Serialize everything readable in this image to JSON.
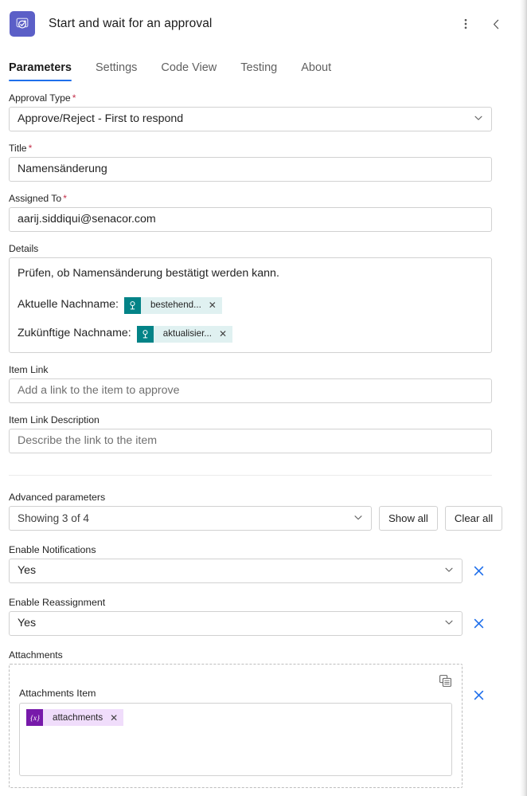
{
  "header": {
    "title": "Start and wait for an approval",
    "app_icon": "approval-icon",
    "more_icon": "more-vertical-icon",
    "collapse_icon": "chevron-left-icon"
  },
  "tabs": [
    {
      "label": "Parameters",
      "active": true
    },
    {
      "label": "Settings",
      "active": false
    },
    {
      "label": "Code View",
      "active": false
    },
    {
      "label": "Testing",
      "active": false
    },
    {
      "label": "About",
      "active": false
    }
  ],
  "fields": {
    "approval_type": {
      "label": "Approval Type",
      "required": true,
      "value": "Approve/Reject - First to respond"
    },
    "title": {
      "label": "Title",
      "required": true,
      "value": "Namensänderung"
    },
    "assigned_to": {
      "label": "Assigned To",
      "required": true,
      "value": "aarij.siddiqui@senacor.com"
    },
    "details": {
      "label": "Details",
      "line1": "Prüfen, ob Namensänderung bestätigt werden kann.",
      "line2_label": "Aktuelle Nachname:",
      "line2_token": "bestehend...",
      "line3_label": "Zukünftige Nachname:",
      "line3_token": "aktualisier..."
    },
    "item_link": {
      "label": "Item Link",
      "placeholder": "Add a link to the item to approve",
      "value": ""
    },
    "item_link_description": {
      "label": "Item Link Description",
      "placeholder": "Describe the link to the item",
      "value": ""
    }
  },
  "advanced": {
    "label": "Advanced parameters",
    "select_value": "Showing 3 of 4",
    "show_all_label": "Show all",
    "clear_all_label": "Clear all",
    "enable_notifications": {
      "label": "Enable Notifications",
      "value": "Yes"
    },
    "enable_reassignment": {
      "label": "Enable Reassignment",
      "value": "Yes"
    },
    "attachments": {
      "label": "Attachments",
      "item_label": "Attachments Item",
      "token": "attachments",
      "copy_icon": "duplicate-icon"
    }
  },
  "colors": {
    "accent_blue": "#1f6feb",
    "app_icon_purple": "#5b5fc7",
    "required_red": "#c4314b",
    "sharepoint_teal": "#038387",
    "variable_purple": "#7719aa"
  }
}
